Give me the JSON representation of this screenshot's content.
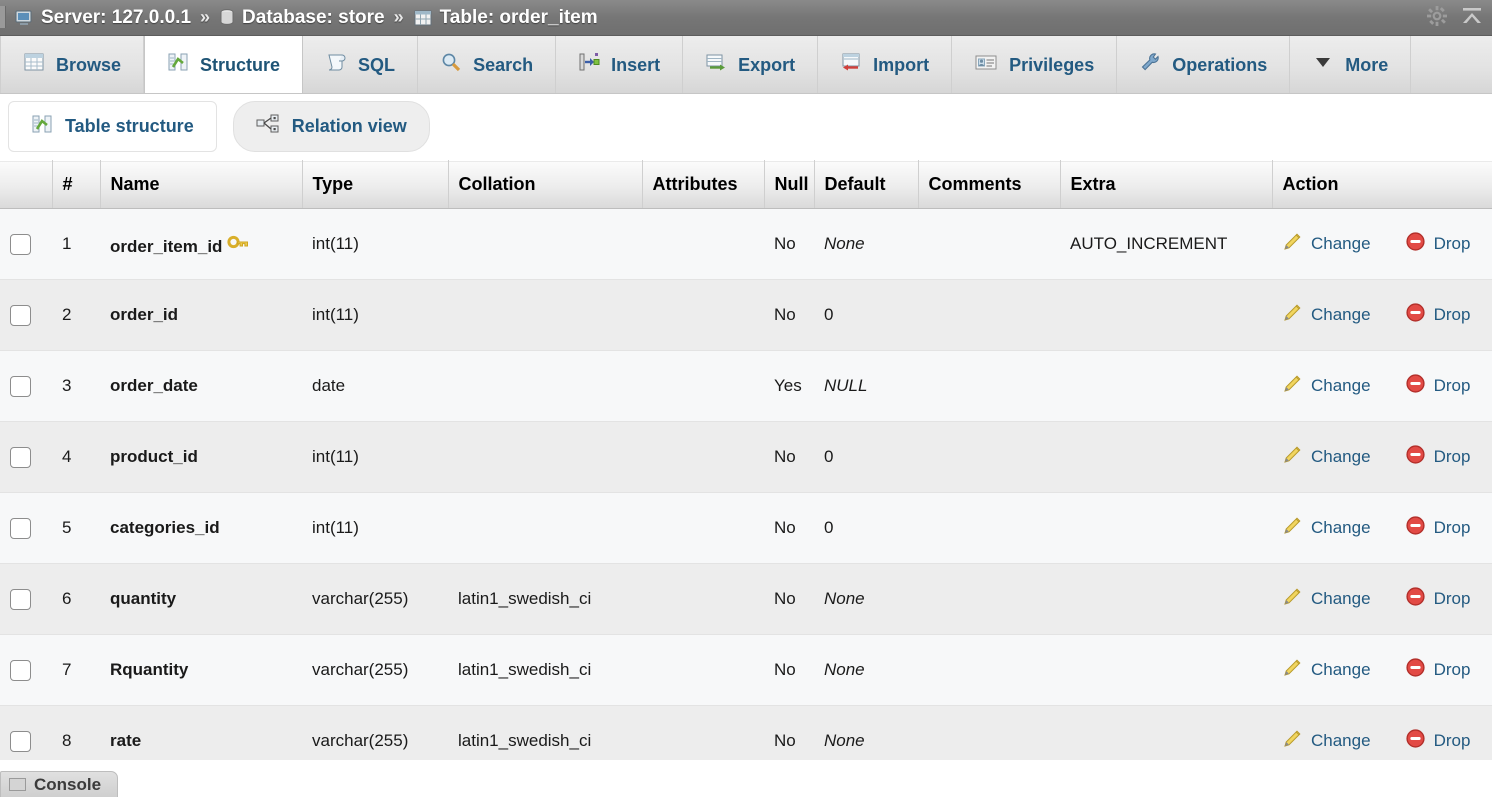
{
  "breadcrumb": {
    "server_icon": "server-icon",
    "server": "Server: 127.0.0.1",
    "sep1": "»",
    "database_icon": "database-icon",
    "database": "Database: store",
    "sep2": "»",
    "table_icon": "table-icon",
    "table": "Table: order_item",
    "settings_icon": "gear-icon",
    "collapse_icon": "collapse-up-icon"
  },
  "tabs": [
    {
      "label": "Browse",
      "icon": "browse-grid-icon",
      "active": false
    },
    {
      "label": "Structure",
      "icon": "structure-icon",
      "active": true
    },
    {
      "label": "SQL",
      "icon": "sql-scroll-icon",
      "active": false
    },
    {
      "label": "Search",
      "icon": "search-icon",
      "active": false
    },
    {
      "label": "Insert",
      "icon": "insert-icon",
      "active": false
    },
    {
      "label": "Export",
      "icon": "export-icon",
      "active": false
    },
    {
      "label": "Import",
      "icon": "import-icon",
      "active": false
    },
    {
      "label": "Privileges",
      "icon": "privileges-icon",
      "active": false
    },
    {
      "label": "Operations",
      "icon": "wrench-icon",
      "active": false
    },
    {
      "label": "More",
      "icon": "chevron-down-icon",
      "active": false
    }
  ],
  "subtabs": [
    {
      "label": "Table structure",
      "icon": "structure-icon",
      "style": "plain"
    },
    {
      "label": "Relation view",
      "icon": "relation-view-icon",
      "style": "pill"
    }
  ],
  "table": {
    "headers": [
      "#",
      "Name",
      "Type",
      "Collation",
      "Attributes",
      "Null",
      "Default",
      "Comments",
      "Extra",
      "Action"
    ],
    "action_labels": {
      "change": "Change",
      "drop": "Drop"
    },
    "rows": [
      {
        "num": "1",
        "name": "order_item_id",
        "key": true,
        "type": "int(11)",
        "collation": "",
        "attributes": "",
        "null": "No",
        "default": "None",
        "default_italic": true,
        "comments": "",
        "extra": "AUTO_INCREMENT"
      },
      {
        "num": "2",
        "name": "order_id",
        "key": false,
        "type": "int(11)",
        "collation": "",
        "attributes": "",
        "null": "No",
        "default": "0",
        "default_italic": false,
        "comments": "",
        "extra": ""
      },
      {
        "num": "3",
        "name": "order_date",
        "key": false,
        "type": "date",
        "collation": "",
        "attributes": "",
        "null": "Yes",
        "default": "NULL",
        "default_italic": true,
        "comments": "",
        "extra": ""
      },
      {
        "num": "4",
        "name": "product_id",
        "key": false,
        "type": "int(11)",
        "collation": "",
        "attributes": "",
        "null": "No",
        "default": "0",
        "default_italic": false,
        "comments": "",
        "extra": ""
      },
      {
        "num": "5",
        "name": "categories_id",
        "key": false,
        "type": "int(11)",
        "collation": "",
        "attributes": "",
        "null": "No",
        "default": "0",
        "default_italic": false,
        "comments": "",
        "extra": ""
      },
      {
        "num": "6",
        "name": "quantity",
        "key": false,
        "type": "varchar(255)",
        "collation": "latin1_swedish_ci",
        "attributes": "",
        "null": "No",
        "default": "None",
        "default_italic": true,
        "comments": "",
        "extra": ""
      },
      {
        "num": "7",
        "name": "Rquantity",
        "key": false,
        "type": "varchar(255)",
        "collation": "latin1_swedish_ci",
        "attributes": "",
        "null": "No",
        "default": "None",
        "default_italic": true,
        "comments": "",
        "extra": ""
      },
      {
        "num": "8",
        "name": "rate",
        "key": false,
        "type": "varchar(255)",
        "collation": "latin1_swedish_ci",
        "attributes": "",
        "null": "No",
        "default": "None",
        "default_italic": true,
        "comments": "",
        "extra": ""
      }
    ]
  },
  "console": {
    "label": "Console"
  },
  "colors": {
    "topbar": "#767676",
    "link": "#235a81",
    "row_odd": "#f7f8f9",
    "row_even": "#ededed",
    "key_icon": "#e8c03a",
    "drop_icon": "#d9423c"
  }
}
